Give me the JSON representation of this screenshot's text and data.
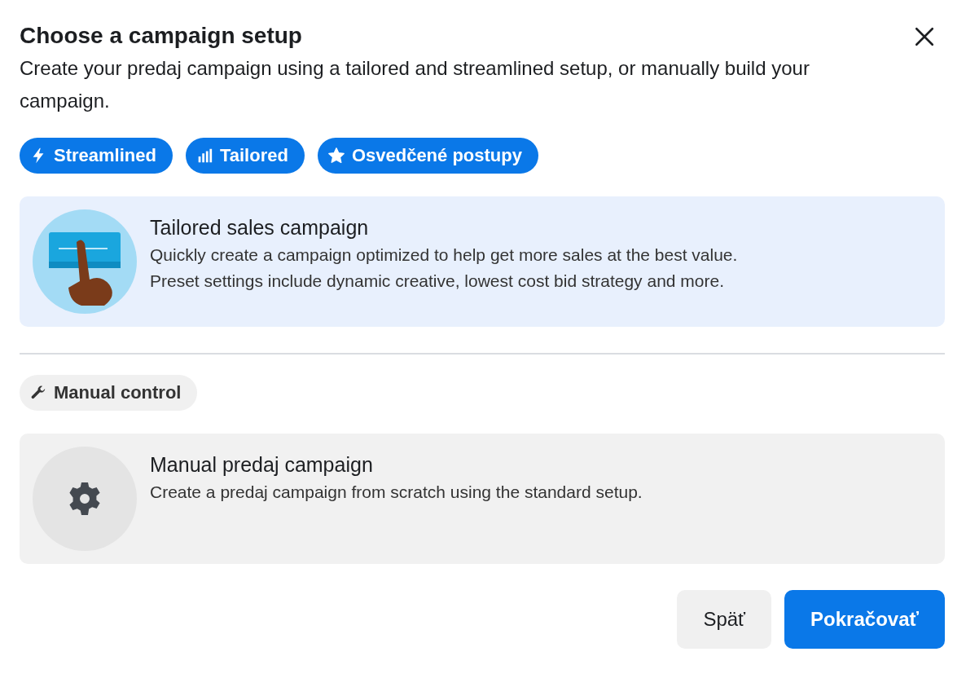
{
  "dialog": {
    "title": "Choose a campaign setup",
    "subtitle": "Create your predaj campaign using a tailored and streamlined setup, or manually build your campaign."
  },
  "sections": [
    {
      "tags": [
        {
          "kind": "bolt",
          "label": "Streamlined"
        },
        {
          "kind": "bars",
          "label": "Tailored"
        },
        {
          "kind": "star",
          "label": "Osvedčené postupy"
        }
      ],
      "option": {
        "kind": "tap",
        "selected": true,
        "title": "Tailored sales campaign",
        "description_lines": [
          "Quickly create a campaign optimized to help get more sales at the best value.",
          "Preset settings include dynamic creative, lowest cost bid strategy and more."
        ]
      }
    },
    {
      "tags": [
        {
          "kind": "wrench",
          "label": "Manual control"
        }
      ],
      "option": {
        "kind": "gear",
        "selected": false,
        "title": "Manual predaj campaign",
        "description_lines": [
          "Create a predaj campaign from scratch using the standard setup."
        ]
      }
    }
  ],
  "buttons": [
    {
      "kind": "secondary",
      "label": "Späť"
    },
    {
      "kind": "primary",
      "label": "Pokračovať"
    }
  ]
}
